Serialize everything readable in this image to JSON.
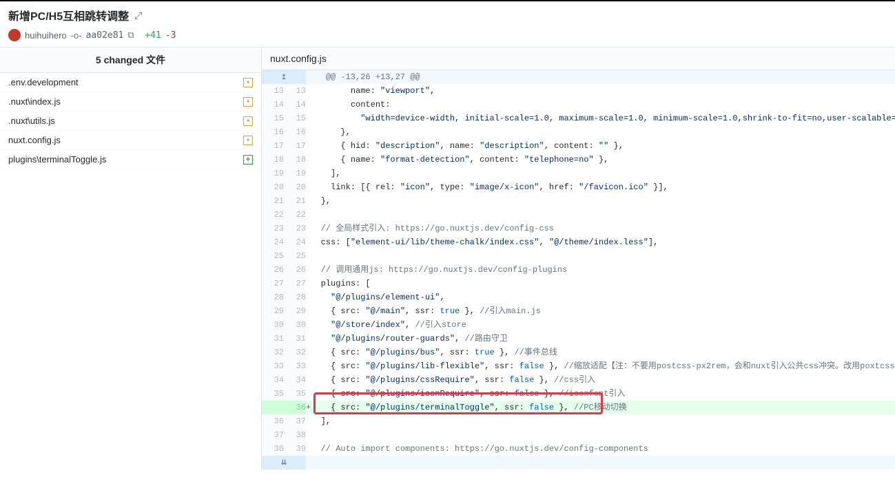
{
  "header": {
    "title": "新增PC/H5互相跳转调整",
    "author": "huihuihero",
    "commit_hash": "aa02e81",
    "additions": "+41",
    "deletions": "-3"
  },
  "sidebar": {
    "title": "5 changed 文件",
    "files": [
      {
        "name": ".env.development",
        "status": "M"
      },
      {
        "name": ".nuxt\\index.js",
        "status": "M"
      },
      {
        "name": ".nuxt\\utils.js",
        "status": "M"
      },
      {
        "name": "nuxt.config.js",
        "status": "M"
      },
      {
        "name": "plugins\\terminalToggle.js",
        "status": "A"
      }
    ]
  },
  "diff": {
    "filename": "nuxt.config.js",
    "hunk": "@@ -13,26 +13,27 @@",
    "lines": [
      {
        "o": "13",
        "n": "13",
        "m": "",
        "t": "        name: \"viewport\","
      },
      {
        "o": "14",
        "n": "14",
        "m": "",
        "t": "        content:"
      },
      {
        "o": "15",
        "n": "15",
        "m": "",
        "t": "          \"width=device-width, initial-scale=1.0, maximum-scale=1.0, minimum-scale=1.0,shrink-to-fit=no,user-scalable=no\","
      },
      {
        "o": "16",
        "n": "16",
        "m": "",
        "t": "      },"
      },
      {
        "o": "17",
        "n": "17",
        "m": "",
        "t": "      { hid: \"description\", name: \"description\", content: \"\" },"
      },
      {
        "o": "18",
        "n": "18",
        "m": "",
        "t": "      { name: \"format-detection\", content: \"telephone=no\" },"
      },
      {
        "o": "19",
        "n": "19",
        "m": "",
        "t": "    ],"
      },
      {
        "o": "20",
        "n": "20",
        "m": "",
        "t": "    link: [{ rel: \"icon\", type: \"image/x-icon\", href: \"/favicon.ico\" }],"
      },
      {
        "o": "21",
        "n": "21",
        "m": "",
        "t": "  },"
      },
      {
        "o": "22",
        "n": "22",
        "m": "",
        "t": ""
      },
      {
        "o": "23",
        "n": "23",
        "m": "",
        "t": "  // 全局样式引入: https://go.nuxtjs.dev/config-css",
        "cm": true
      },
      {
        "o": "24",
        "n": "24",
        "m": "",
        "t": "  css: [\"element-ui/lib/theme-chalk/index.css\", \"@/theme/index.less\"],"
      },
      {
        "o": "25",
        "n": "25",
        "m": "",
        "t": ""
      },
      {
        "o": "26",
        "n": "26",
        "m": "",
        "t": "  // 调用通用js: https://go.nuxtjs.dev/config-plugins",
        "cm": true
      },
      {
        "o": "27",
        "n": "27",
        "m": "",
        "t": "  plugins: ["
      },
      {
        "o": "28",
        "n": "28",
        "m": "",
        "t": "    \"@/plugins/element-ui\","
      },
      {
        "o": "29",
        "n": "29",
        "m": "",
        "t": "    { src: \"@/main\", ssr: true }, //引入main.js"
      },
      {
        "o": "30",
        "n": "30",
        "m": "",
        "t": "    \"@/store/index\", //引入store"
      },
      {
        "o": "31",
        "n": "31",
        "m": "",
        "t": "    \"@/plugins/router-guards\", //路由守卫"
      },
      {
        "o": "32",
        "n": "32",
        "m": "",
        "t": "    { src: \"@/plugins/bus\", ssr: true }, //事件总线"
      },
      {
        "o": "33",
        "n": "33",
        "m": "",
        "t": "    { src: \"@/plugins/lib-flexible\", ssr: false }, //缩放适配【注：不要用postcss-px2rem，会和nuxt引入公共css冲突。改用poxtcss-pxtorem】"
      },
      {
        "o": "34",
        "n": "34",
        "m": "",
        "t": "    { src: \"@/plugins/cssRequire\", ssr: false }, //css引入"
      },
      {
        "o": "35",
        "n": "35",
        "m": "",
        "t": "    { src: \"@/plugins/iconRequire\", ssr: false }, //iconfont引入"
      },
      {
        "o": "",
        "n": "36",
        "m": "+",
        "t": "    { src: \"@/plugins/terminalToggle\", ssr: false }, //PC移动切换",
        "add": true
      },
      {
        "o": "36",
        "n": "37",
        "m": "",
        "t": "  ],"
      },
      {
        "o": "37",
        "n": "38",
        "m": "",
        "t": ""
      },
      {
        "o": "38",
        "n": "39",
        "m": "",
        "t": "  // Auto import components: https://go.nuxtjs.dev/config-components",
        "cm": true
      }
    ]
  }
}
